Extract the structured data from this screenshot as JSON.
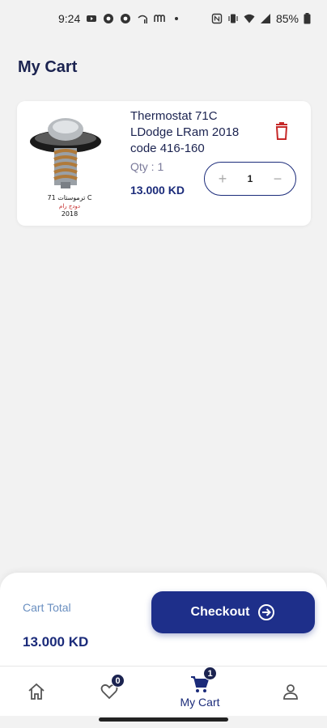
{
  "status_bar": {
    "time": "9:24",
    "battery": "85%"
  },
  "page": {
    "title": "My Cart"
  },
  "cart_items": [
    {
      "name": "Thermostat 71C LDodge LRam 2018 code 416-160",
      "qty_label": "Qty : 1",
      "price": "13.000 KD",
      "quantity": "1",
      "image_caption": [
        "ترموستات 71 C",
        "دودج رام",
        "2018"
      ]
    }
  ],
  "summary": {
    "total_label": "Cart Total",
    "total_value": "13.000 KD",
    "checkout_label": "Checkout"
  },
  "nav": {
    "wishlist_badge": "0",
    "cart_badge": "1",
    "cart_label": "My Cart"
  },
  "colors": {
    "primary": "#1e2f8a",
    "delete": "#c62828",
    "background": "#f2f2f2"
  },
  "icons": [
    "youtube-icon",
    "chrome-icon",
    "wifi-icon",
    "signal-icon",
    "battery-icon",
    "delete-icon",
    "plus-icon",
    "minus-icon",
    "arrow-right-circle-icon",
    "home-icon",
    "heart-icon",
    "cart-icon",
    "person-icon"
  ]
}
